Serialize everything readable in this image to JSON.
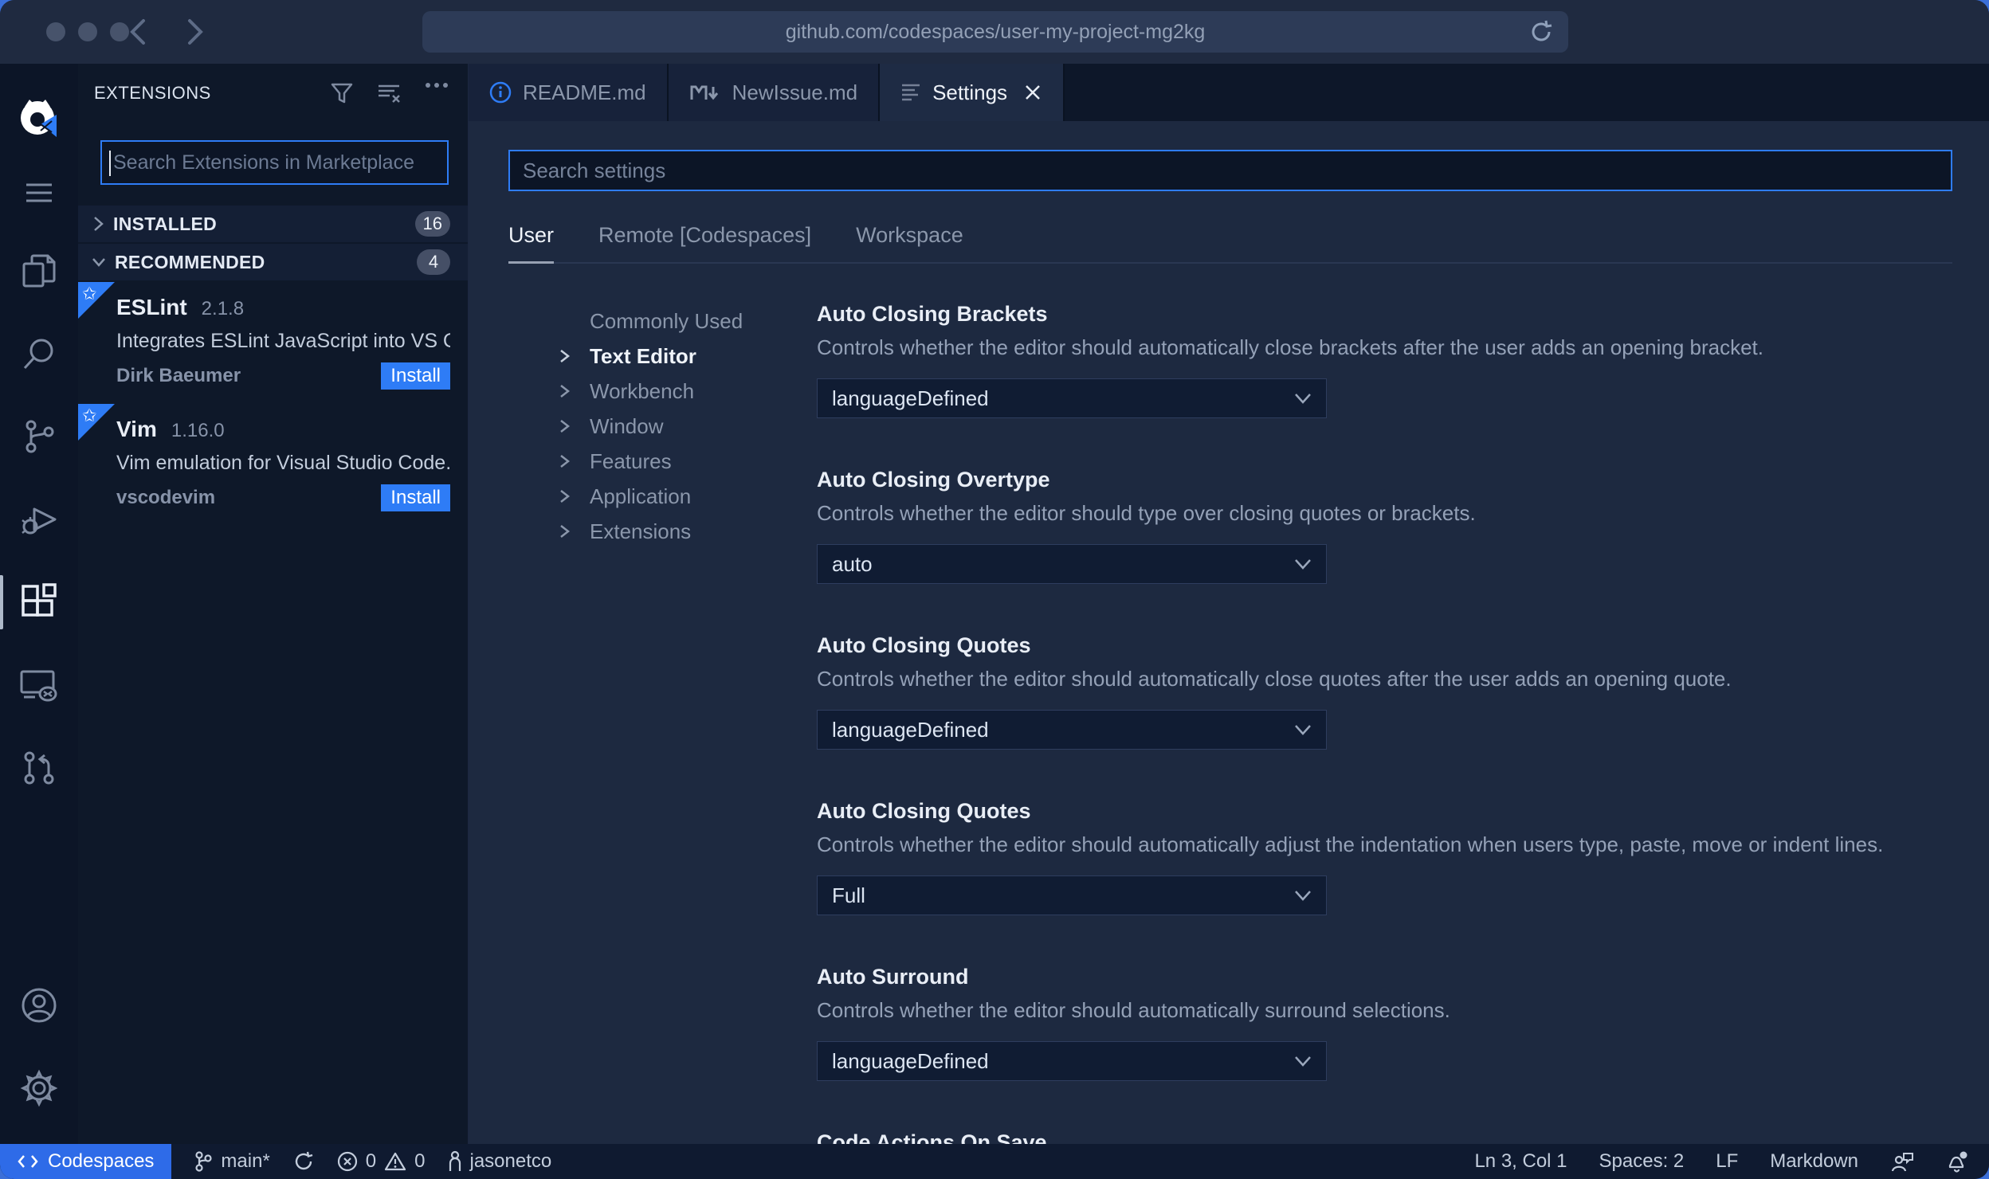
{
  "colors": {
    "accent_blue": "#2e7cf6",
    "status_blue": "#2e6be8",
    "badge_bg": "#454f66",
    "chrome_bg": "#1f2a40",
    "editor_bg": "#1d2940",
    "sidebar_bg": "#0e1829"
  },
  "browser": {
    "url": "github.com/codespaces/user-my-project-mg2kg"
  },
  "activity_bar": {
    "icons": [
      "codespaces-logo",
      "menu",
      "explorer",
      "search",
      "source-control",
      "run-debug",
      "extensions",
      "remote-explorer",
      "pull-requests",
      "account",
      "settings-gear"
    ],
    "active": "extensions"
  },
  "sidebar": {
    "title": "EXTENSIONS",
    "header_icons": [
      "filter-icon",
      "clear-filter-icon",
      "more-actions-icon"
    ],
    "search_placeholder": "Search Extensions in Marketplace",
    "sections": [
      {
        "label": "INSTALLED",
        "count": "16",
        "state": "collapsed"
      },
      {
        "label": "RECOMMENDED",
        "count": "4",
        "state": "expanded"
      }
    ],
    "extensions": [
      {
        "name": "ESLint",
        "version": "2.1.8",
        "description": "Integrates ESLint JavaScript into VS C...",
        "author": "Dirk Baeumer",
        "action": "Install"
      },
      {
        "name": "Vim",
        "version": "1.16.0",
        "description": "Vim emulation for Visual Studio Code...",
        "author": "vscodevim",
        "action": "Install"
      }
    ]
  },
  "editor_tabs": [
    {
      "label": "README.md",
      "icon": "info-icon",
      "active": false
    },
    {
      "label": "NewIssue.md",
      "icon": "markdown-icon",
      "active": false
    },
    {
      "label": "Settings",
      "icon": "settings-editor-icon",
      "active": true
    }
  ],
  "settings": {
    "search_placeholder": "Search settings",
    "scopes": [
      "User",
      "Remote [Codespaces]",
      "Workspace"
    ],
    "active_scope": "User",
    "toc": [
      "Commonly Used",
      "Text Editor",
      "Workbench",
      "Window",
      "Features",
      "Application",
      "Extensions"
    ],
    "active_toc": "Text Editor",
    "items": [
      {
        "title": "Auto Closing Brackets",
        "description": "Controls whether the editor should automatically close brackets after the user adds an opening bracket.",
        "value": "languageDefined"
      },
      {
        "title": "Auto Closing Overtype",
        "description": "Controls whether the editor should type over closing quotes or brackets.",
        "value": "auto"
      },
      {
        "title": "Auto Closing Quotes",
        "description": "Controls whether the editor should automatically close quotes after the user adds an opening quote.",
        "value": "languageDefined"
      },
      {
        "title": "Auto Closing Quotes",
        "description": "Controls whether the editor should automatically adjust the indentation when users type, paste, move or indent lines.",
        "value": "Full"
      },
      {
        "title": "Auto Surround",
        "description": "Controls whether the editor should automatically surround selections.",
        "value": "languageDefined"
      },
      {
        "title": "Code Actions On Save"
      }
    ]
  },
  "status_bar": {
    "left": {
      "remote_label": "Codespaces",
      "branch": "main*",
      "errors": "0",
      "warnings": "0",
      "user": "jasonetco"
    },
    "right": {
      "line_col": "Ln 3, Col 1",
      "spaces": "Spaces: 2",
      "eol": "LF",
      "language": "Markdown"
    }
  }
}
